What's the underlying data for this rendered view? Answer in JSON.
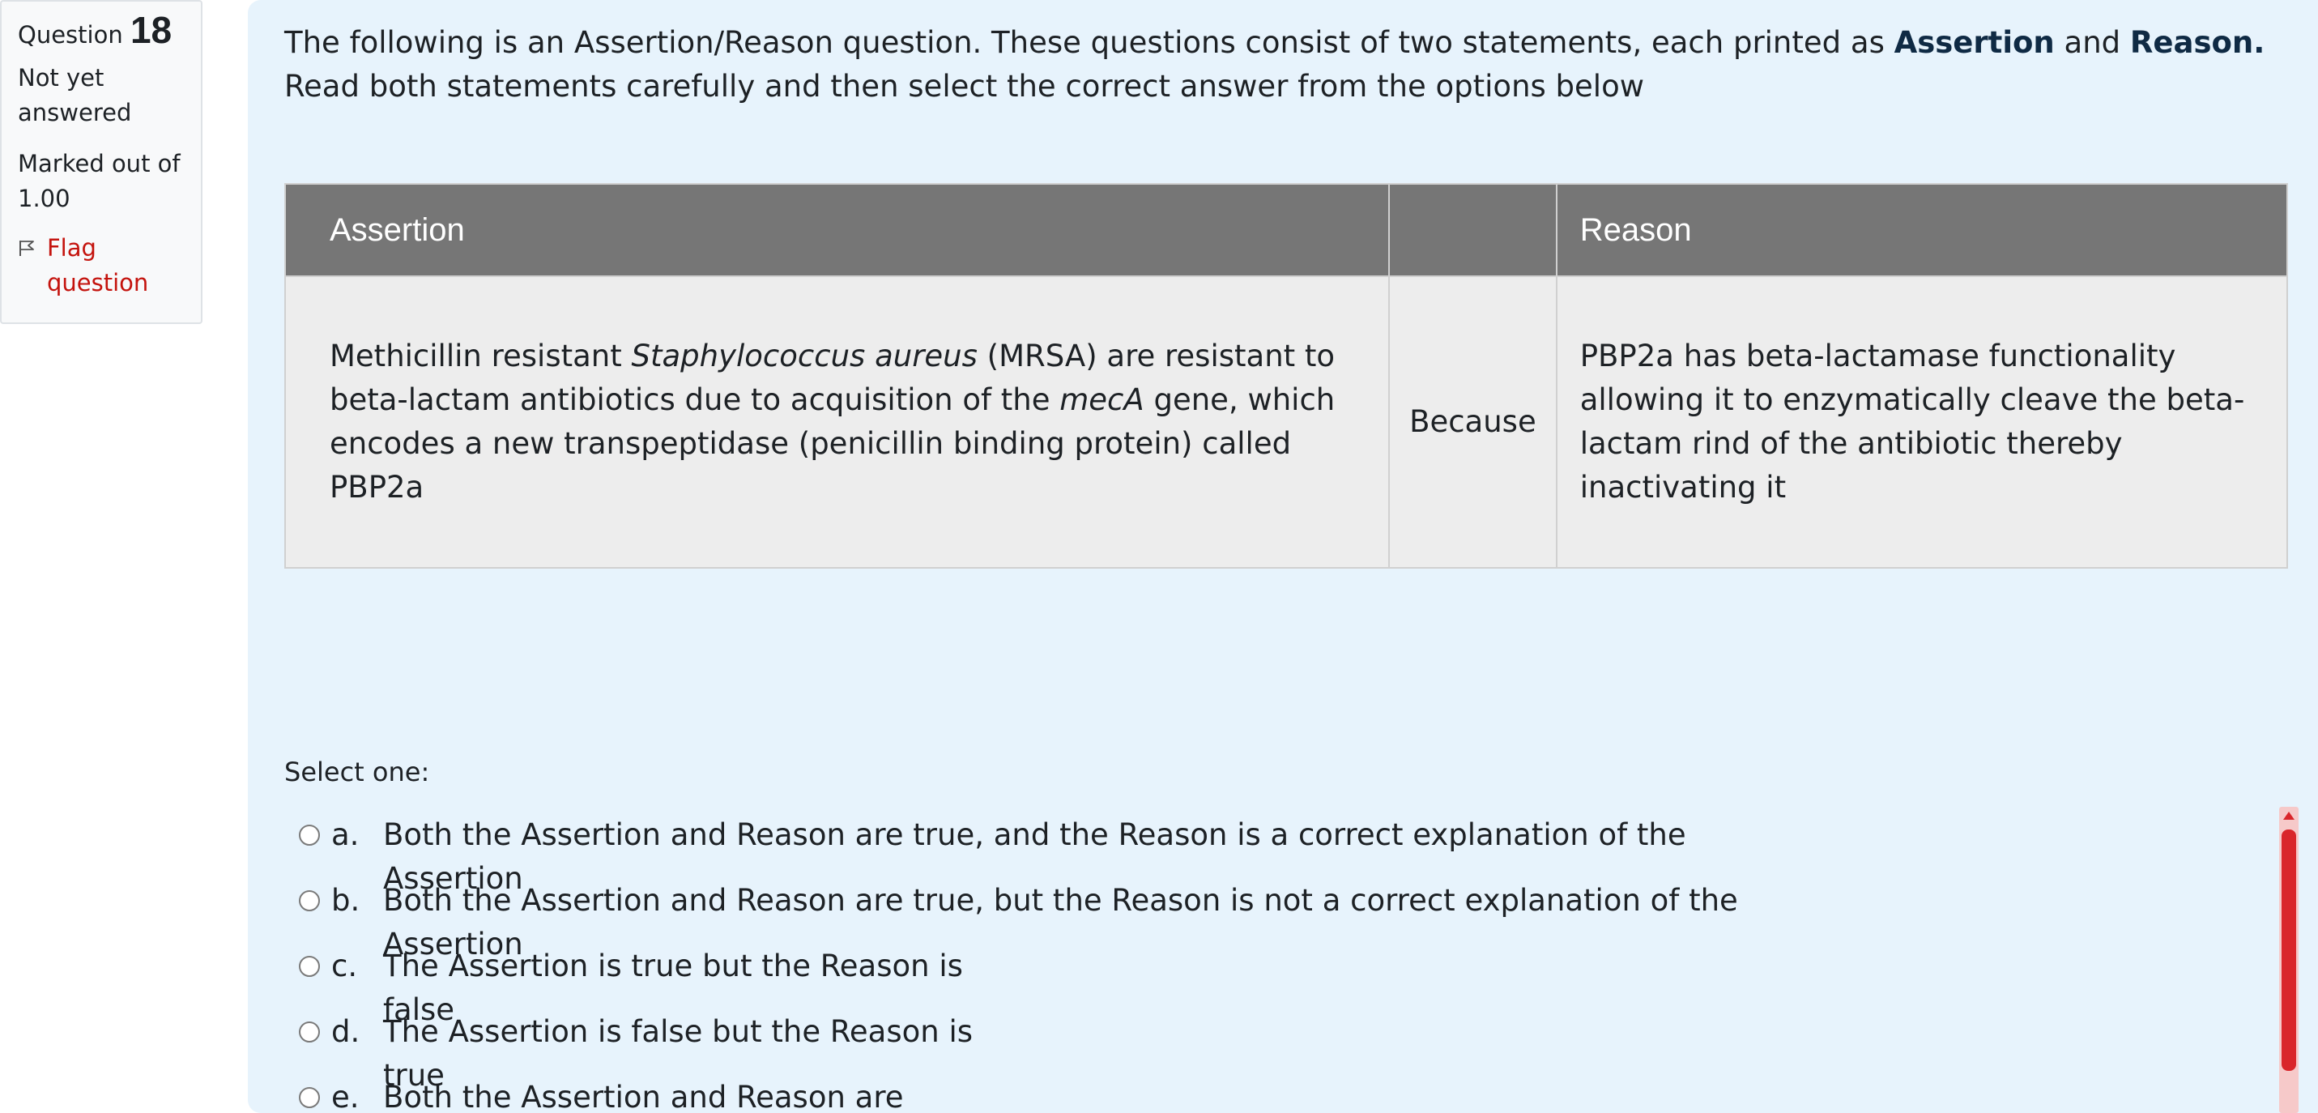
{
  "question_info": {
    "label": "Question",
    "number": "18",
    "state": "Not yet answered",
    "grade": "Marked out of 1.00",
    "flag_label": "Flag question"
  },
  "intro": {
    "line1_prefix": "The following is an Assertion/Reason question.  These questions consist of two statements, each printed as ",
    "bold_assertion": "Assertion",
    "and": " and ",
    "bold_reason": "Reason.",
    "line2": "Read both statements carefully and then select the correct answer from the options below"
  },
  "table": {
    "header_assertion": "Assertion",
    "header_middle": "",
    "header_reason": "Reason",
    "assertion_part1": "Methicillin resistant ",
    "assertion_italic1": "Staphylococcus aureus",
    "assertion_part2": " (MRSA) are resistant to beta-lactam antibiotics due to acquisition of the ",
    "assertion_italic2": "mecA",
    "assertion_part3": " gene, which encodes a new transpeptidase (penicillin binding protein) called PBP2a",
    "connector": "Because",
    "reason": "PBP2a has beta-lactamase functionality allowing it to enzymatically cleave the beta-lactam rind of the antibiotic thereby inactivating it"
  },
  "answer_prompt": "Select one:",
  "answers": [
    {
      "letter": "a.",
      "line1": "Both the Assertion and Reason are true, and the Reason is a correct explanation of the",
      "line2": "Assertion"
    },
    {
      "letter": "b.",
      "line1": "Both the Assertion and Reason are true, but the Reason is not a correct explanation of the",
      "line2": "Assertion"
    },
    {
      "letter": "c.",
      "line1": "The Assertion is true but the Reason is",
      "line2": "false"
    },
    {
      "letter": "d.",
      "line1": "The Assertion is false but the Reason is",
      "line2": "true"
    },
    {
      "letter": "e.",
      "line1": "Both the Assertion and Reason are",
      "line2": ""
    }
  ],
  "colors": {
    "content_bg": "#e7f3fc",
    "table_header_bg": "#767676",
    "table_cell_bg": "#ededed",
    "flag_red": "#c4130d",
    "scrollbar_red": "#d9262b"
  },
  "icons": {
    "flag": "flag-icon",
    "radio": "radio-unchecked-icon",
    "scroll_up": "arrow-up-icon"
  }
}
